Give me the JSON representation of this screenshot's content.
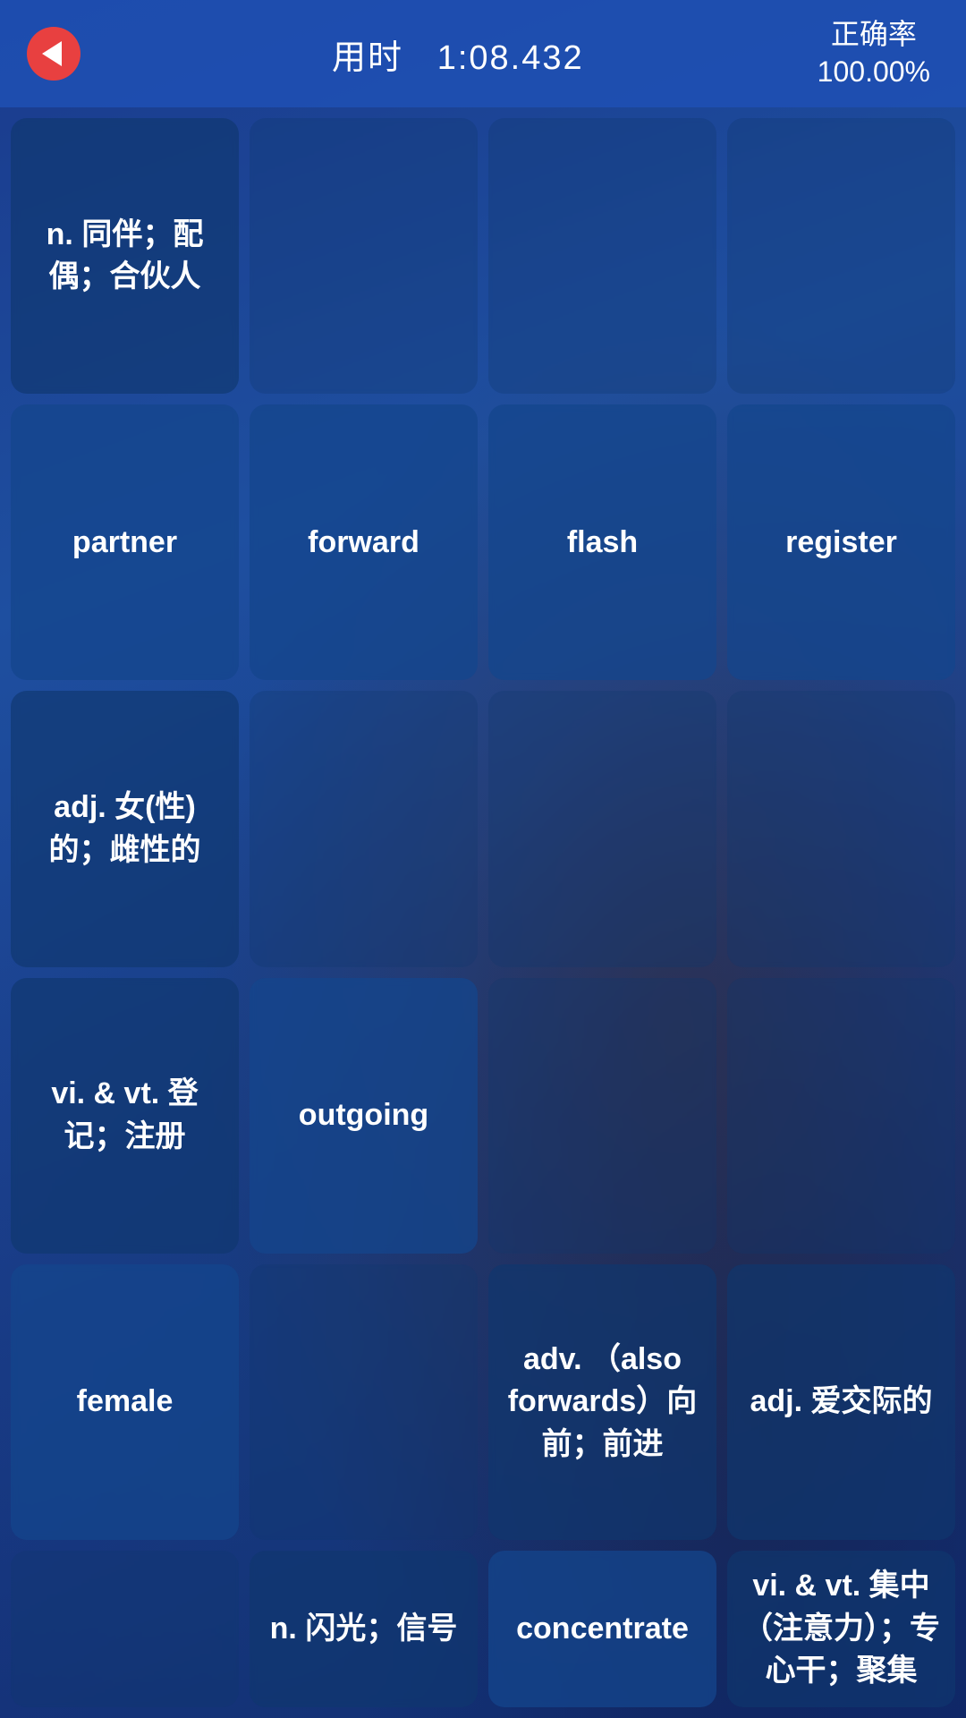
{
  "header": {
    "back_label": "back",
    "timer_prefix": "用时",
    "timer_value": "1:08.432",
    "accuracy_label": "正确率",
    "accuracy_value": "100.00%"
  },
  "grid": {
    "cells": [
      {
        "id": "c00",
        "type": "def",
        "text": "n. 同伴；配偶；合伙人",
        "row": 1,
        "col": 1
      },
      {
        "id": "c01",
        "type": "empty",
        "text": "",
        "row": 1,
        "col": 2
      },
      {
        "id": "c02",
        "type": "empty",
        "text": "",
        "row": 1,
        "col": 3
      },
      {
        "id": "c03",
        "type": "empty",
        "text": "",
        "row": 1,
        "col": 4
      },
      {
        "id": "c10",
        "type": "word",
        "text": "partner",
        "row": 2,
        "col": 1
      },
      {
        "id": "c11",
        "type": "word",
        "text": "forward",
        "row": 2,
        "col": 2
      },
      {
        "id": "c12",
        "type": "word",
        "text": "flash",
        "row": 2,
        "col": 3
      },
      {
        "id": "c13",
        "type": "word",
        "text": "register",
        "row": 2,
        "col": 4
      },
      {
        "id": "c20",
        "type": "def",
        "text": "adj. 女(性)的；雌性的",
        "row": 3,
        "col": 1
      },
      {
        "id": "c21",
        "type": "empty",
        "text": "",
        "row": 3,
        "col": 2
      },
      {
        "id": "c22",
        "type": "empty",
        "text": "",
        "row": 3,
        "col": 3
      },
      {
        "id": "c23",
        "type": "empty",
        "text": "",
        "row": 3,
        "col": 4
      },
      {
        "id": "c30",
        "type": "def",
        "text": "vi. & vt. 登记；注册",
        "row": 4,
        "col": 1
      },
      {
        "id": "c31",
        "type": "word",
        "text": "outgoing",
        "row": 4,
        "col": 2
      },
      {
        "id": "c32",
        "type": "empty",
        "text": "",
        "row": 4,
        "col": 3
      },
      {
        "id": "c33",
        "type": "empty",
        "text": "",
        "row": 4,
        "col": 4
      },
      {
        "id": "c40",
        "type": "word",
        "text": "female",
        "row": 5,
        "col": 1
      },
      {
        "id": "c41",
        "type": "empty",
        "text": "",
        "row": 5,
        "col": 2
      },
      {
        "id": "c42",
        "type": "def",
        "text": "adv. （also forwards）向前；前进",
        "row": 5,
        "col": 3
      },
      {
        "id": "c43",
        "type": "def",
        "text": "adj. 爱交际的",
        "row": 5,
        "col": 4
      },
      {
        "id": "c50",
        "type": "empty",
        "text": "",
        "row": 6,
        "col": 1
      },
      {
        "id": "c51",
        "type": "def",
        "text": "n. 闪光；信号",
        "row": 6,
        "col": 2
      },
      {
        "id": "c52",
        "type": "word",
        "text": "concentrate",
        "row": 6,
        "col": 3
      },
      {
        "id": "c53",
        "type": "def",
        "text": "vi. & vt. 集中（注意力）；专心干；聚集",
        "row": 6,
        "col": 4
      }
    ]
  }
}
